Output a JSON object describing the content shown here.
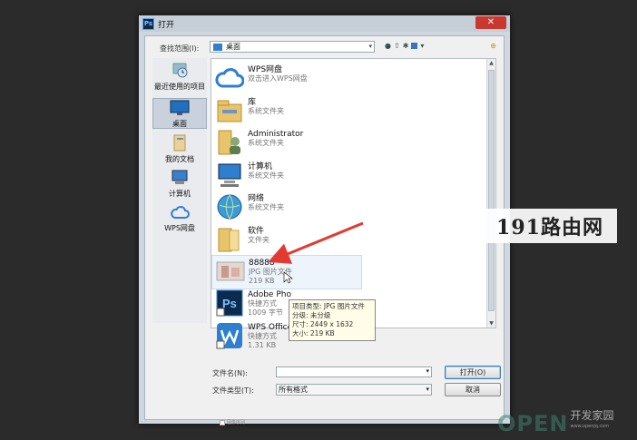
{
  "window": {
    "title": "打开",
    "logo": "Ps",
    "close_glyph": "✕"
  },
  "toolbar": {
    "lookin_label": "查找范围(I):",
    "lookin_value": "桌面",
    "dropdown_glyph": "▾",
    "extra_glyph": "⊕"
  },
  "places": [
    {
      "label": "最近使用的项目",
      "icon": "recent-items-icon"
    },
    {
      "label": "桌面",
      "icon": "desktop-icon",
      "selected": true
    },
    {
      "label": "我的文档",
      "icon": "documents-icon"
    },
    {
      "label": "计算机",
      "icon": "computer-icon"
    },
    {
      "label": "WPS网盘",
      "icon": "cloud-icon"
    }
  ],
  "files": [
    {
      "name": "WPS网盘",
      "sub1": "双击进入WPS网盘",
      "sub2": "",
      "icon": "cloud-icon"
    },
    {
      "name": "库",
      "sub1": "系统文件夹",
      "sub2": "",
      "icon": "library-icon"
    },
    {
      "name": "Administrator",
      "sub1": "系统文件夹",
      "sub2": "",
      "icon": "user-folder-icon"
    },
    {
      "name": "计算机",
      "sub1": "系统文件夹",
      "sub2": "",
      "icon": "computer-icon"
    },
    {
      "name": "网络",
      "sub1": "系统文件夹",
      "sub2": "",
      "icon": "network-icon"
    },
    {
      "name": "软件",
      "sub1": "文件夹",
      "sub2": "",
      "icon": "folder-icon"
    },
    {
      "name": "88888",
      "sub1": "JPG 图片文件",
      "sub2": "219 KB",
      "icon": "image-thumbnail-icon"
    },
    {
      "name": "Adobe Pho",
      "sub1": "快捷方式",
      "sub2": "1009 字节",
      "icon": "photoshop-icon"
    },
    {
      "name": "WPS Office",
      "sub1": "快捷方式",
      "sub2": "1.31 KB",
      "icon": "wps-icon"
    }
  ],
  "tooltip": {
    "line1": "项目类型: JPG 图片文件",
    "line2": "分级: 未分级",
    "line3": "尺寸: 2449 x 1632",
    "line4": "大小: 219 KB"
  },
  "form": {
    "filename_label": "文件名(N):",
    "filename_value": "",
    "filetype_label": "文件类型(T):",
    "filetype_value": "所有格式",
    "open_button": "打开(O)",
    "cancel_button": "取消",
    "sequence_label": "图像序列"
  },
  "watermarks": {
    "brand_191": "191路由网",
    "open_big": "OPEN",
    "open_cn": "开发家园",
    "open_url": "www.openjq.com"
  },
  "colors": {
    "accent": "#2f7fd1",
    "close": "#c9382f",
    "arrow": "#e23a30"
  }
}
